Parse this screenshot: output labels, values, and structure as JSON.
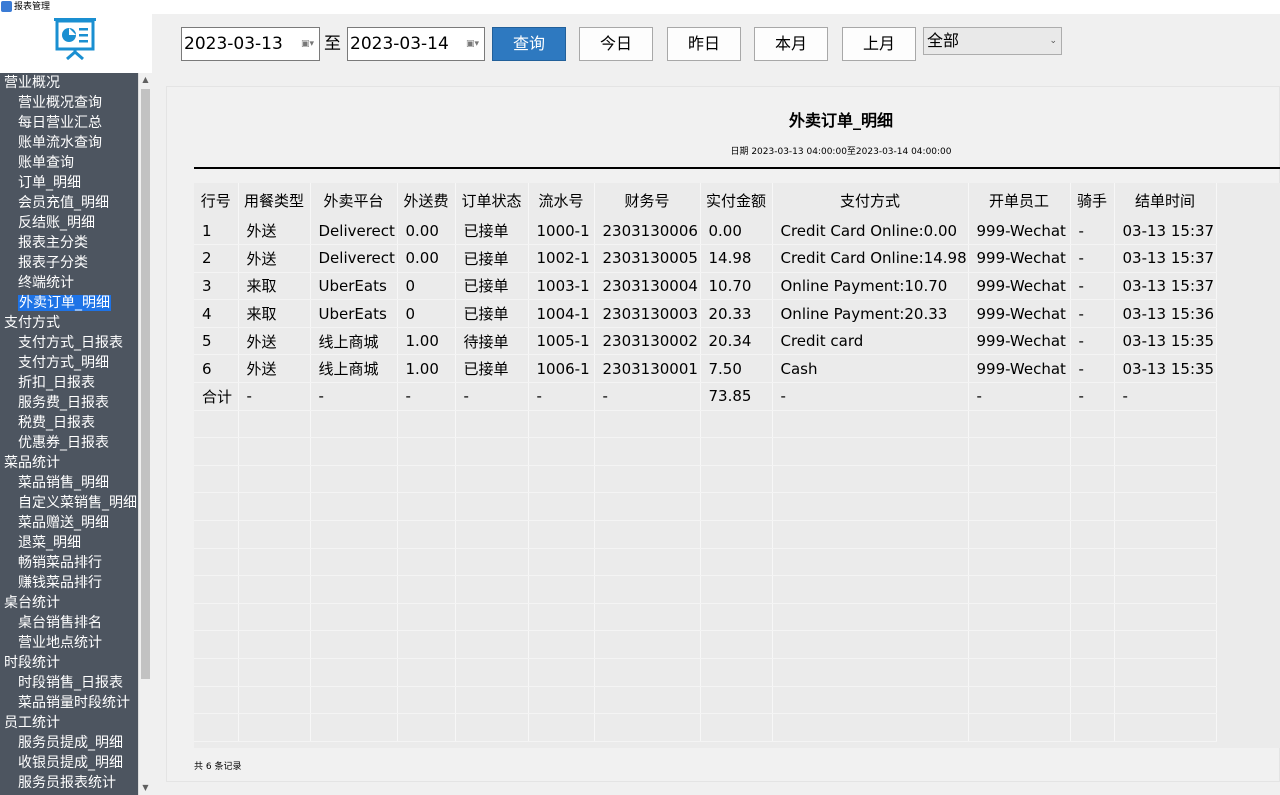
{
  "window": {
    "title": "报表管理"
  },
  "sidebar": {
    "items": [
      {
        "type": "group",
        "label": "营业概况"
      },
      {
        "type": "sub",
        "label": "营业概况查询"
      },
      {
        "type": "sub",
        "label": "每日营业汇总"
      },
      {
        "type": "sub",
        "label": "账单流水查询"
      },
      {
        "type": "sub",
        "label": "账单查询"
      },
      {
        "type": "sub",
        "label": "订单_明细"
      },
      {
        "type": "sub",
        "label": "会员充值_明细"
      },
      {
        "type": "sub",
        "label": "反结账_明细"
      },
      {
        "type": "sub",
        "label": "报表主分类"
      },
      {
        "type": "sub",
        "label": "报表子分类"
      },
      {
        "type": "sub",
        "label": "终端统计"
      },
      {
        "type": "sub",
        "label": "外卖订单_明细",
        "selected": true
      },
      {
        "type": "group",
        "label": "支付方式"
      },
      {
        "type": "sub",
        "label": "支付方式_日报表"
      },
      {
        "type": "sub",
        "label": "支付方式_明细"
      },
      {
        "type": "sub",
        "label": "折扣_日报表"
      },
      {
        "type": "sub",
        "label": "服务费_日报表"
      },
      {
        "type": "sub",
        "label": "税费_日报表"
      },
      {
        "type": "sub",
        "label": "优惠券_日报表"
      },
      {
        "type": "group",
        "label": "菜品统计"
      },
      {
        "type": "sub",
        "label": "菜品销售_明细"
      },
      {
        "type": "sub",
        "label": "自定义菜销售_明细"
      },
      {
        "type": "sub",
        "label": "菜品赠送_明细"
      },
      {
        "type": "sub",
        "label": "退菜_明细"
      },
      {
        "type": "sub",
        "label": "畅销菜品排行"
      },
      {
        "type": "sub",
        "label": "赚钱菜品排行"
      },
      {
        "type": "group",
        "label": "桌台统计"
      },
      {
        "type": "sub",
        "label": "桌台销售排名"
      },
      {
        "type": "sub",
        "label": "营业地点统计"
      },
      {
        "type": "group",
        "label": "时段统计"
      },
      {
        "type": "sub",
        "label": "时段销售_日报表"
      },
      {
        "type": "sub",
        "label": "菜品销量时段统计"
      },
      {
        "type": "group",
        "label": "员工统计"
      },
      {
        "type": "sub",
        "label": "服务员提成_明细"
      },
      {
        "type": "sub",
        "label": "收银员提成_明细"
      },
      {
        "type": "sub",
        "label": "服务员报表统计"
      }
    ]
  },
  "toolbar": {
    "start_date": "2023-03-13",
    "to_label": "至",
    "end_date": "2023-03-14",
    "query_label": "查询",
    "today_label": "今日",
    "yesterday_label": "昨日",
    "this_month_label": "本月",
    "last_month_label": "上月",
    "filter_value": "全部"
  },
  "report": {
    "title": "外卖订单_明细",
    "date_range": "日期 2023-03-13 04:00:00至2023-03-14 04:00:00",
    "columns": [
      "行号",
      "用餐类型",
      "外卖平台",
      "外送费",
      "订单状态",
      "流水号",
      "财务号",
      "实付金额",
      "支付方式",
      "开单员工",
      "骑手",
      "结单时间"
    ],
    "rows": [
      [
        "1",
        "外送",
        "Deliverect",
        "0.00",
        "已接单",
        "1000-1",
        "2303130006",
        "0.00",
        "Credit Card Online:0.00",
        "999-Wechat",
        "-",
        "03-13 15:37"
      ],
      [
        "2",
        "外送",
        "Deliverect",
        "0.00",
        "已接单",
        "1002-1",
        "2303130005",
        "14.98",
        "Credit Card Online:14.98",
        "999-Wechat",
        "-",
        "03-13 15:37"
      ],
      [
        "3",
        "来取",
        "UberEats",
        "0",
        "已接单",
        "1003-1",
        "2303130004",
        "10.70",
        "Online Payment:10.70",
        "999-Wechat",
        "-",
        "03-13 15:37"
      ],
      [
        "4",
        "来取",
        "UberEats",
        "0",
        "已接单",
        "1004-1",
        "2303130003",
        "20.33",
        "Online Payment:20.33",
        "999-Wechat",
        "-",
        "03-13 15:36"
      ],
      [
        "5",
        "外送",
        "线上商城",
        "1.00",
        "待接单",
        "1005-1",
        "2303130002",
        "20.34",
        "Credit card",
        "999-Wechat",
        "-",
        "03-13 15:35"
      ],
      [
        "6",
        "外送",
        "线上商城",
        "1.00",
        "已接单",
        "1006-1",
        "2303130001",
        "7.50",
        "Cash",
        "999-Wechat",
        "-",
        "03-13 15:35"
      ]
    ],
    "total_row": [
      "合计",
      "-",
      "-",
      "-",
      "-",
      "-",
      "-",
      "73.85",
      "-",
      "-",
      "-",
      "-"
    ],
    "record_count": "共 6 条记录"
  },
  "colors": {
    "accent": "#2e79c0",
    "sidebar_bg": "#4d5560",
    "selected": "#1e73e6"
  }
}
